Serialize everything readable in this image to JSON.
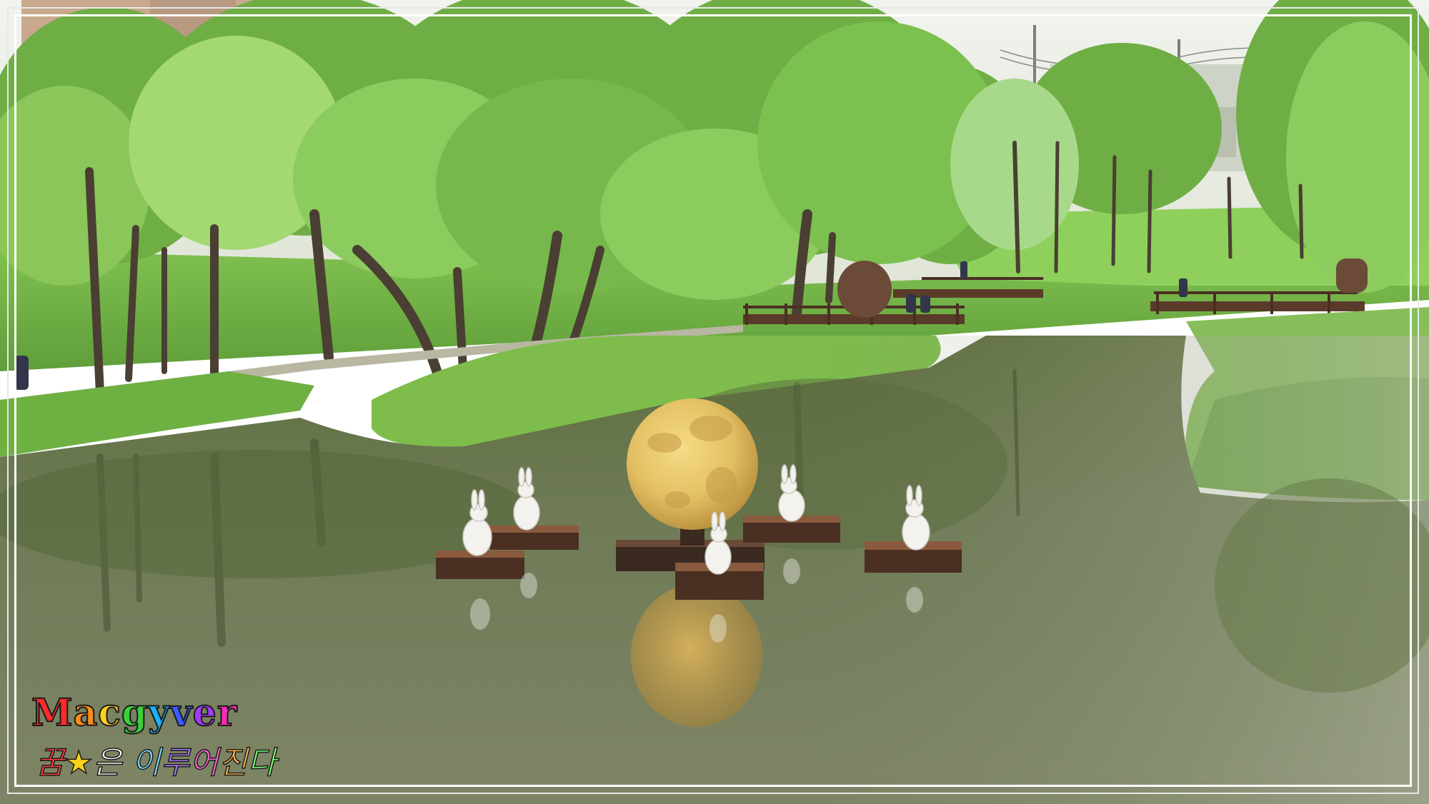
{
  "image": {
    "subject": "park-pond-moon-sculpture",
    "colors": {
      "sky": "#e9ece6",
      "foliage_light": "#9fd16a",
      "foliage_mid": "#6fae45",
      "foliage_dark": "#3f7a2c",
      "grass": "#7fbf4f",
      "water": "#6f7a58",
      "water_light": "#a3a98c",
      "moon": "#e8c76a",
      "moon_shade": "#c9a24c",
      "wood": "#5a3b2a",
      "wood_top": "#8a5a3e",
      "rabbit": "#f4f2ee",
      "frame": "#ffffff"
    }
  },
  "watermark": {
    "title": "Macgyver",
    "title_colors": [
      "#ff2a2a",
      "#ff8c1a",
      "#ffd21a",
      "#3ad13a",
      "#1ab0ff",
      "#3a5cff",
      "#a33aff",
      "#ff2ab4"
    ],
    "subtitle_parts": [
      "꿈",
      "★",
      "은 ",
      "이루어진다"
    ],
    "subtitle_colors": [
      "#ff4040",
      "#ffd21a",
      "#ffffff",
      "#7ee0ff"
    ]
  }
}
